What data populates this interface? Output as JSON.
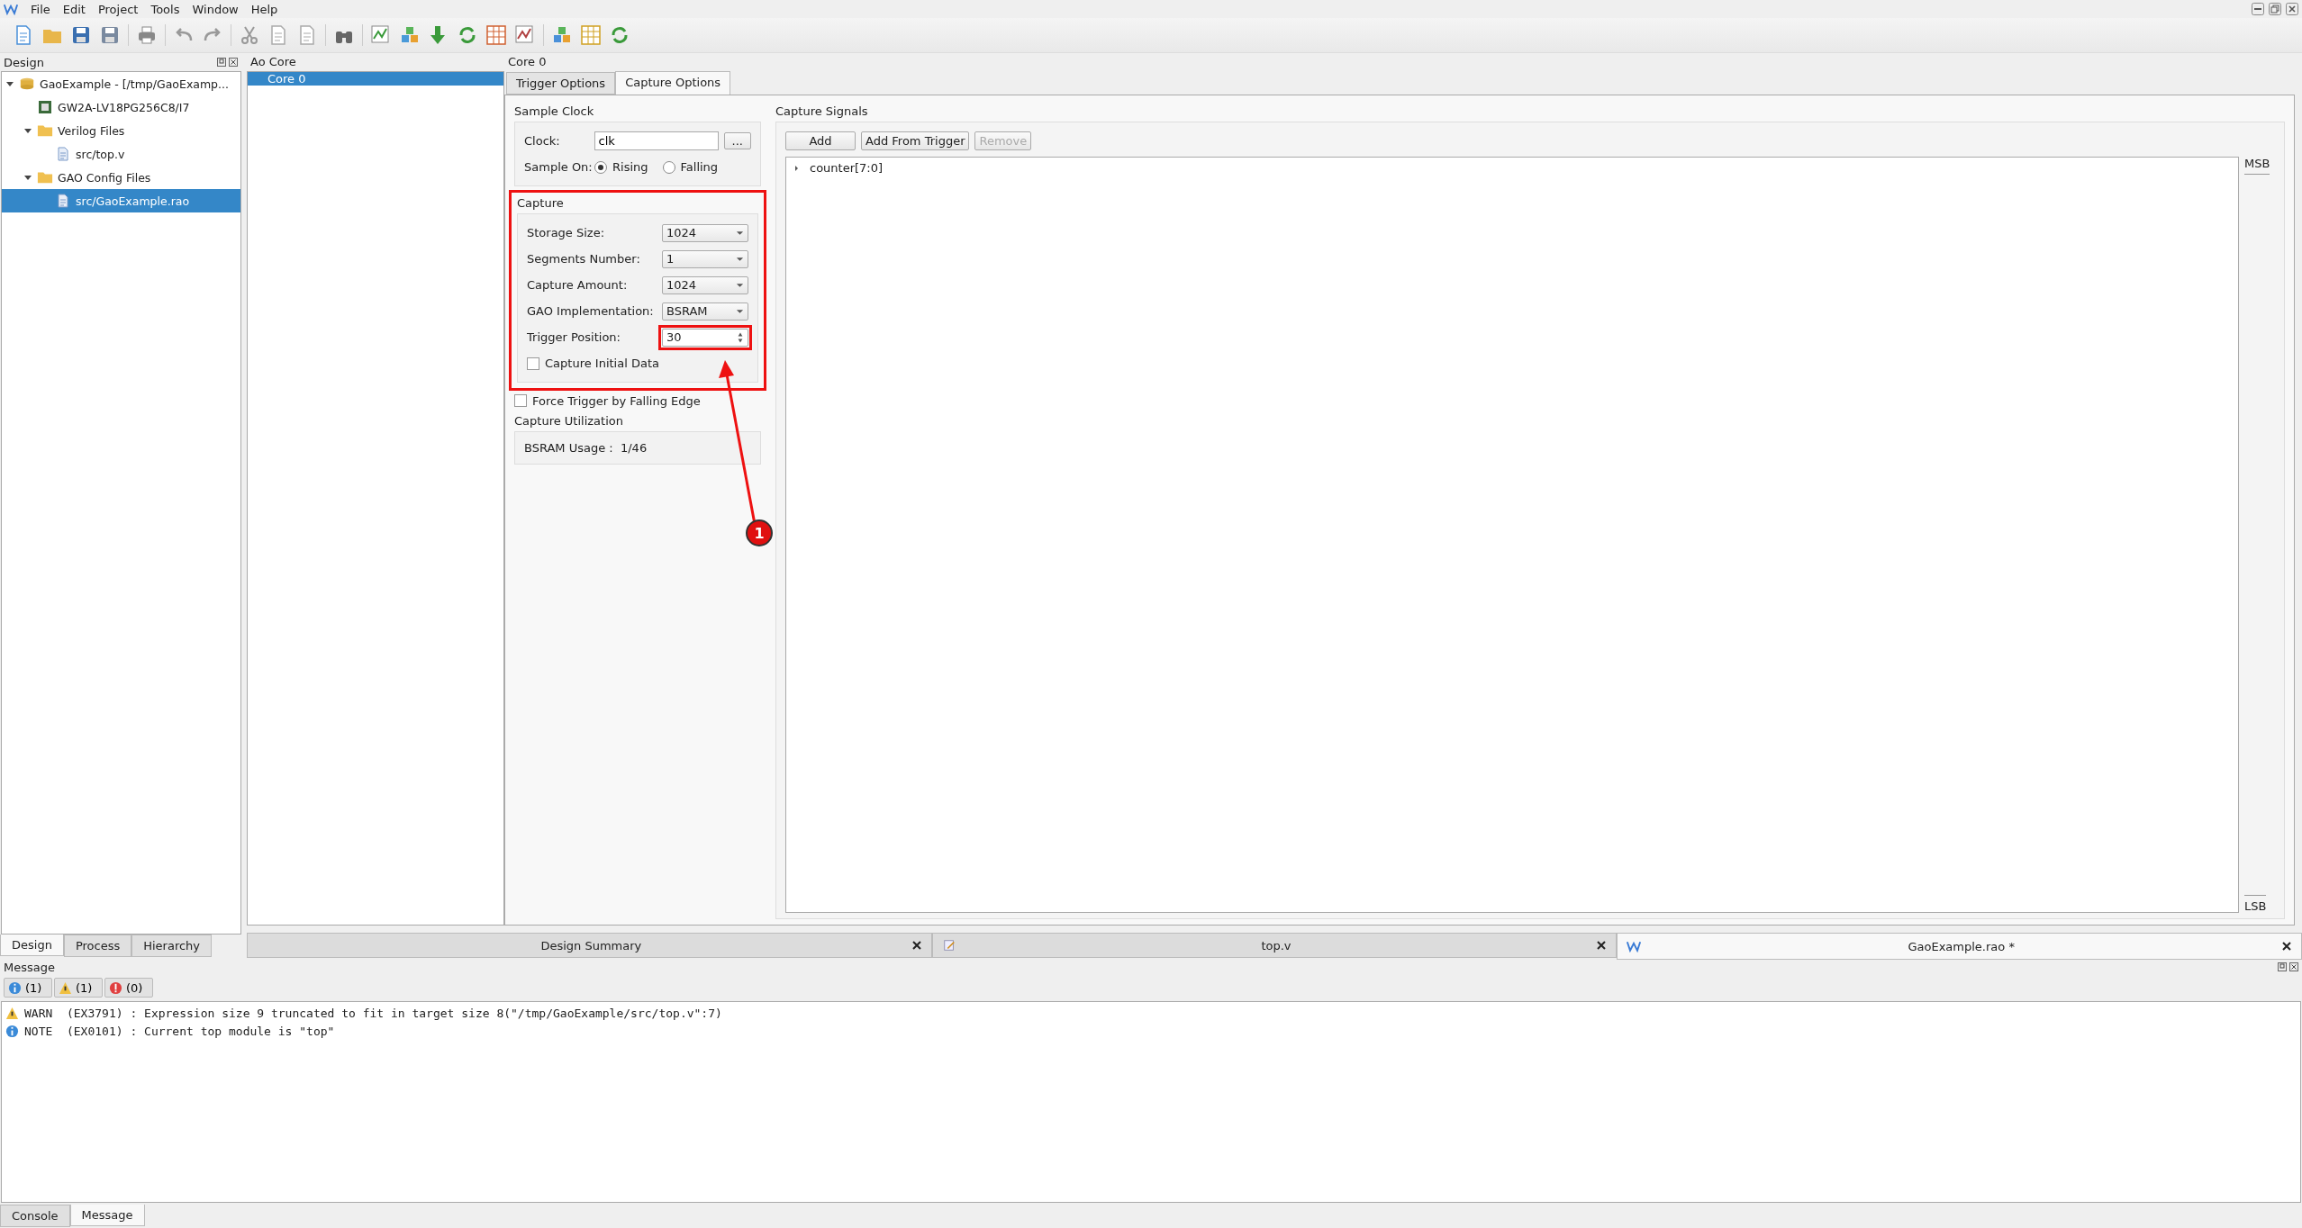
{
  "menu": [
    "File",
    "Edit",
    "Project",
    "Tools",
    "Window",
    "Help"
  ],
  "design_panel": {
    "title": "Design",
    "tree": [
      {
        "label": "GaoExample - [/tmp/GaoExamp...",
        "kind": "project",
        "expanded": true,
        "selected": false,
        "children": [
          {
            "label": "GW2A-LV18PG256C8/I7",
            "kind": "chip",
            "selected": false
          },
          {
            "label": "Verilog Files",
            "kind": "folder",
            "expanded": true,
            "selected": false,
            "children": [
              {
                "label": "src/top.v",
                "kind": "file",
                "selected": false
              }
            ]
          },
          {
            "label": "GAO Config Files",
            "kind": "folder",
            "expanded": true,
            "selected": false,
            "children": [
              {
                "label": "src/GaoExample.rao",
                "kind": "file",
                "selected": true
              }
            ]
          }
        ]
      }
    ],
    "tabs": [
      {
        "label": "Design",
        "selected": true
      },
      {
        "label": "Process",
        "selected": false
      },
      {
        "label": "Hierarchy",
        "selected": false
      }
    ]
  },
  "ao_core": {
    "title": "Ao Core",
    "items": [
      {
        "label": "Core 0",
        "selected": true
      }
    ]
  },
  "core_panel": {
    "title": "Core 0",
    "tabs": [
      {
        "label": "Trigger Options",
        "selected": false
      },
      {
        "label": "Capture Options",
        "selected": true
      }
    ],
    "sample_clock": {
      "title": "Sample Clock",
      "clock_label": "Clock:",
      "clock_value": "clk",
      "browse": "...",
      "sample_on_label": "Sample On:",
      "options": [
        {
          "label": "Rising",
          "selected": true
        },
        {
          "label": "Falling",
          "selected": false
        }
      ]
    },
    "capture": {
      "title": "Capture",
      "highlighted": true,
      "fields": [
        {
          "label": "Storage Size:",
          "value": "1024",
          "kind": "select",
          "highlighted": false
        },
        {
          "label": "Segments Number:",
          "value": "1",
          "kind": "select",
          "highlighted": false
        },
        {
          "label": "Capture Amount:",
          "value": "1024",
          "kind": "select",
          "highlighted": false
        },
        {
          "label": "GAO Implementation:",
          "value": "BSRAM",
          "kind": "select",
          "highlighted": false
        },
        {
          "label": "Trigger Position:",
          "value": "30",
          "kind": "spin",
          "highlighted": true
        }
      ],
      "initial_data": {
        "label": "Capture Initial Data",
        "checked": false
      }
    },
    "force_trigger": {
      "label": "Force Trigger by Falling Edge",
      "checked": false
    },
    "utilization": {
      "title": "Capture Utilization",
      "text": "BSRAM Usage :  1/46"
    },
    "capture_signals": {
      "title": "Capture Signals",
      "buttons": [
        {
          "label": "Add",
          "disabled": false
        },
        {
          "label": "Add From Trigger",
          "disabled": false
        },
        {
          "label": "Remove",
          "disabled": true
        }
      ],
      "signals": [
        {
          "label": "counter[7:0]",
          "expanded": false
        }
      ],
      "msb": "MSB",
      "lsb": "LSB"
    }
  },
  "annotation": {
    "label": "1"
  },
  "editor_tabs": [
    {
      "label": "Design Summary",
      "kind": "summary",
      "selected": false
    },
    {
      "label": "top.v",
      "kind": "verilog",
      "selected": false
    },
    {
      "label": "GaoExample.rao *",
      "kind": "rao",
      "selected": true
    }
  ],
  "message": {
    "title": "Message",
    "filters": [
      {
        "kind": "info",
        "count": "(1)"
      },
      {
        "kind": "warn",
        "count": "(1)"
      },
      {
        "kind": "error",
        "count": "(0)"
      }
    ],
    "lines": [
      {
        "kind": "warn",
        "text": "WARN  (EX3791) : Expression size 9 truncated to fit in target size 8(\"/tmp/GaoExample/src/top.v\":7)"
      },
      {
        "kind": "info",
        "text": "NOTE  (EX0101) : Current top module is \"top\""
      }
    ]
  },
  "bottom_tabs": [
    {
      "label": "Console",
      "selected": false
    },
    {
      "label": "Message",
      "selected": true
    }
  ]
}
